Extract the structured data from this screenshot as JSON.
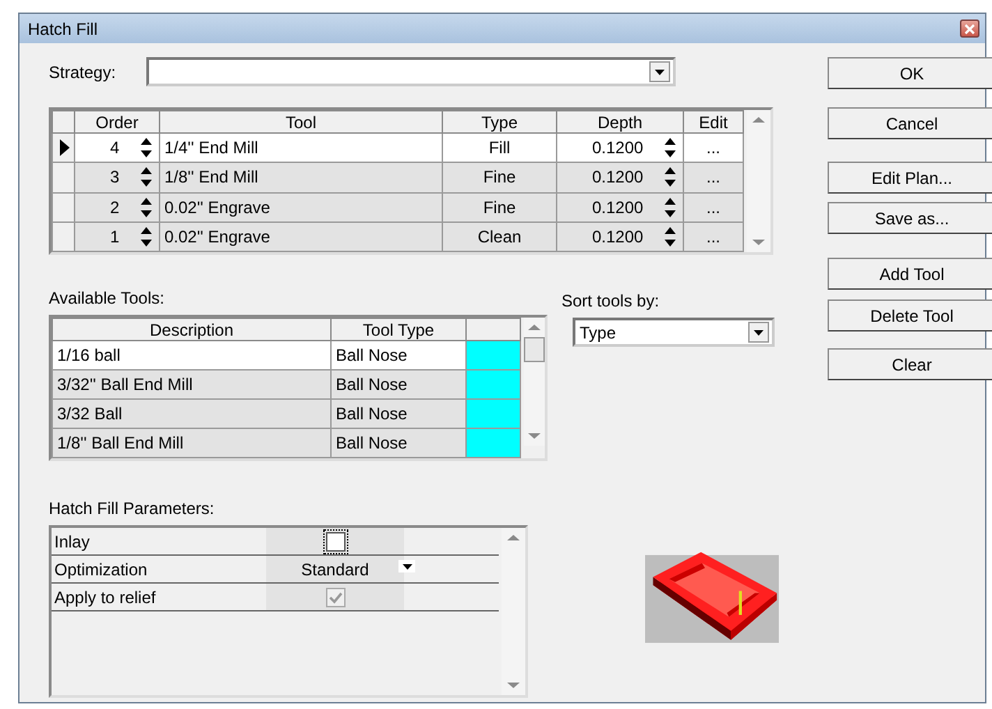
{
  "window": {
    "title": "Hatch Fill"
  },
  "strategy": {
    "label": "Strategy:"
  },
  "plan_table": {
    "columns": [
      "Order",
      "Tool",
      "Type",
      "Depth",
      "Edit"
    ],
    "rows": [
      {
        "order": "4",
        "tool": "1/4'' End Mill",
        "type": "Fill",
        "depth": "0.1200",
        "edit": "...",
        "selected": true
      },
      {
        "order": "3",
        "tool": "1/8'' End Mill",
        "type": "Fine",
        "depth": "0.1200",
        "edit": "...",
        "selected": false
      },
      {
        "order": "2",
        "tool": "0.02'' Engrave",
        "type": "Fine",
        "depth": "0.1200",
        "edit": "...",
        "selected": false
      },
      {
        "order": "1",
        "tool": "0.02'' Engrave",
        "type": "Clean",
        "depth": "0.1200",
        "edit": "...",
        "selected": false
      }
    ]
  },
  "available_tools": {
    "label": "Available Tools:",
    "columns": [
      "Description",
      "Tool Type"
    ],
    "rows": [
      {
        "description": "1/16 ball",
        "tool_type": "Ball Nose",
        "color": "#00ffff",
        "selected": true
      },
      {
        "description": "3/32'' Ball End Mill",
        "tool_type": "Ball Nose",
        "color": "#00ffff",
        "selected": false
      },
      {
        "description": "3/32  Ball",
        "tool_type": "Ball Nose",
        "color": "#00ffff",
        "selected": false
      },
      {
        "description": "1/8'' Ball End Mill",
        "tool_type": "Ball Nose",
        "color": "#00ffff",
        "selected": false
      }
    ]
  },
  "sort": {
    "label": "Sort tools by:",
    "value": "Type"
  },
  "parameters": {
    "label": "Hatch Fill Parameters:",
    "rows": [
      {
        "name": "Inlay",
        "kind": "checkbox",
        "checked": false,
        "disabled": false
      },
      {
        "name": "Optimization",
        "kind": "dropdown",
        "value": "Standard"
      },
      {
        "name": "Apply to relief",
        "kind": "checkbox",
        "checked": true,
        "disabled": true
      }
    ]
  },
  "buttons": [
    "OK",
    "Cancel",
    "Edit Plan...",
    "Save as...",
    "Add Tool",
    "Delete Tool",
    "Clear"
  ]
}
